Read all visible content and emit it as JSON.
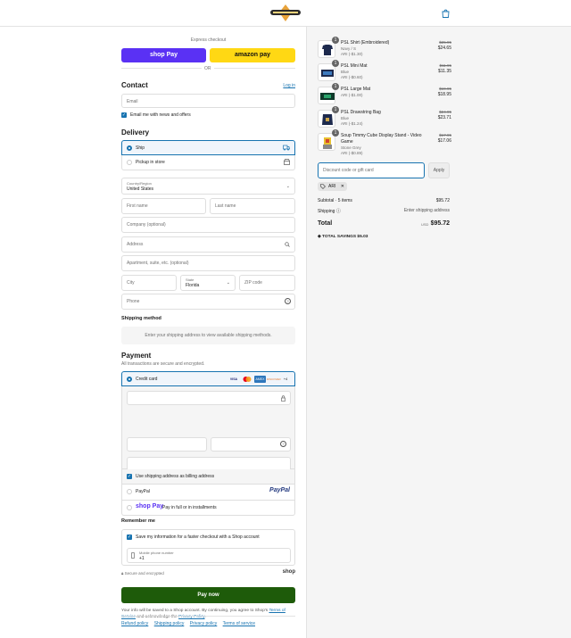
{
  "header": {
    "logo_alt": "store-logo"
  },
  "express": {
    "title": "Express checkout",
    "shop_pay": "shop Pay",
    "amazon_pay": "amazon pay",
    "or": "OR"
  },
  "contact": {
    "title": "Contact",
    "login": "Log in",
    "email_placeholder": "Email",
    "news_label": "Email me with news and offers"
  },
  "delivery": {
    "title": "Delivery",
    "ship": "Ship",
    "pickup": "Pickup in store",
    "country_label": "Country/Region",
    "country_value": "United States",
    "first_name": "First name",
    "last_name": "Last name",
    "company": "Company (optional)",
    "address": "Address",
    "apartment": "Apartment, suite, etc. (optional)",
    "city": "City",
    "state_label": "State",
    "state_value": "Florida",
    "zip": "ZIP code",
    "phone": "Phone"
  },
  "shipping_method": {
    "title": "Shipping method",
    "message": "Enter your shipping address to view available shipping methods."
  },
  "payment": {
    "title": "Payment",
    "subtitle": "All transactions are secure and encrypted.",
    "credit_card": "Credit card",
    "card_brands": [
      "VISA",
      "MC",
      "AMEX",
      "DISCOVER",
      "+4"
    ],
    "billing_same": "Use shipping address as billing address",
    "paypal": "PayPal",
    "paypal_logo": "PayPal",
    "shop_pay_logo": "shop Pay",
    "shop_pay_text": "Pay in full or in installments"
  },
  "remember": {
    "title": "Remember me",
    "save_label": "Save my information for a faster checkout with a Shop account",
    "mobile_label": "Mobile phone number",
    "mobile_value": "+1",
    "secure": "Secure and encrypted",
    "shop_logo": "shop"
  },
  "pay_now": "Pay now",
  "legal": {
    "text1": "Your info will be saved to a Shop account. By continuing, you agree to Shop's",
    "tos": "Terms of Service",
    "text2": "and acknowledge the",
    "privacy": "Privacy Policy",
    "end": "."
  },
  "footer": [
    "Refund policy",
    "Shipping policy",
    "Privacy policy",
    "Terms of service"
  ],
  "order": {
    "items": [
      {
        "qty": "1",
        "name": "PSL Shirt (Embroidered)",
        "variant": "Navy / S",
        "discount": "ARI (-$1.30)",
        "old": "$25.95",
        "price": "$24.65"
      },
      {
        "qty": "1",
        "name": "PSL Mini Mat",
        "variant": "Blue",
        "discount": "ARI (-$0.60)",
        "old": "$11.95",
        "price": "$11.35"
      },
      {
        "qty": "1",
        "name": "PSL Large Mat",
        "variant": "",
        "discount": "ARI (-$1.00)",
        "old": "$19.95",
        "price": "$18.95"
      },
      {
        "qty": "1",
        "name": "PSL Drawstring Bag",
        "variant": "Blue",
        "discount": "ARI (-$1.24)",
        "old": "$24.95",
        "price": "$23.71"
      },
      {
        "qty": "1",
        "name": "Soup Timmy Cube Display Stand - Video Game",
        "variant": "Stone Grey",
        "discount": "ARI (-$0.89)",
        "old": "$17.95",
        "price": "$17.06"
      }
    ],
    "discount_placeholder": "Discount code or gift card",
    "apply": "Apply",
    "code_tag": "ARI",
    "subtotal_label": "Subtotal · 5 items",
    "subtotal_value": "$95.72",
    "shipping_label": "Shipping",
    "shipping_value": "Enter shipping address",
    "total_label": "Total",
    "currency": "USD",
    "total_value": "$95.72",
    "savings_label": "TOTAL SAVINGS",
    "savings_value": "$5.03"
  },
  "colors": {
    "accent": "#1773b0",
    "pay_button": "#1e5b0a",
    "shop_purple": "#5a31f4",
    "amazon_yellow": "#ffd814"
  }
}
